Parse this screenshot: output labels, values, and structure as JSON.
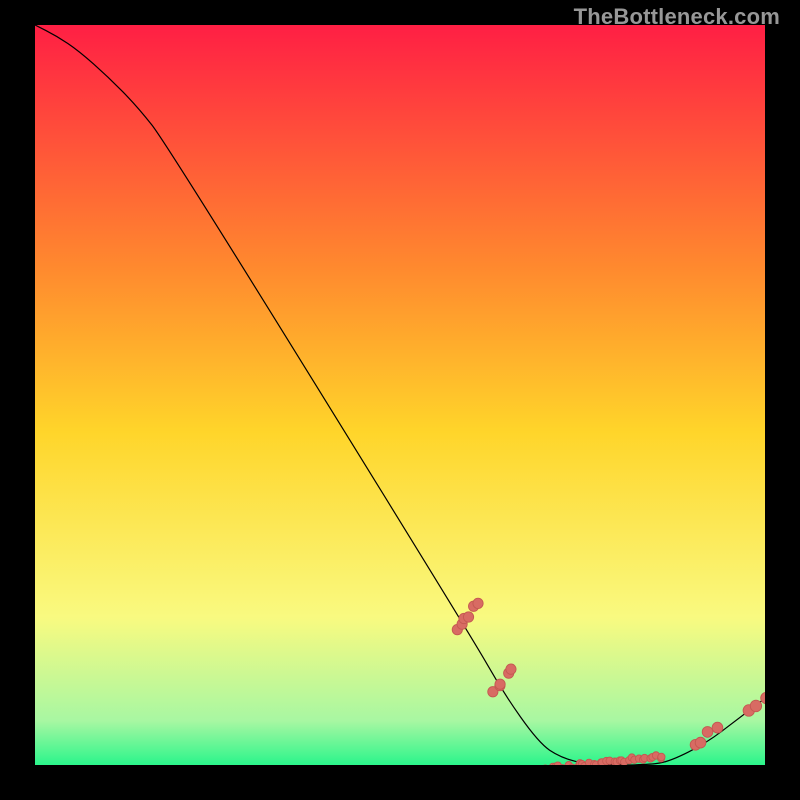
{
  "watermark": "TheBottleneck.com",
  "colors": {
    "background": "#000000",
    "gradient_top": "#ff1f44",
    "gradient_upper_mid": "#ff8a2e",
    "gradient_mid": "#ffd52a",
    "gradient_lower_mid": "#f9fa80",
    "gradient_high": "#a8f7a2",
    "gradient_bottom": "#2bf58b",
    "curve": "#000000",
    "dot_fill": "#d86b63",
    "dot_stroke": "#c45851"
  },
  "chart_data": {
    "type": "line",
    "title": "",
    "xlabel": "",
    "ylabel": "",
    "xlim": [
      0,
      100
    ],
    "ylim": [
      0,
      100
    ],
    "curve": [
      {
        "x": 0,
        "y": 100
      },
      {
        "x": 3,
        "y": 98.5
      },
      {
        "x": 6,
        "y": 96.5
      },
      {
        "x": 10,
        "y": 93
      },
      {
        "x": 14,
        "y": 89
      },
      {
        "x": 18,
        "y": 84
      },
      {
        "x": 60,
        "y": 17
      },
      {
        "x": 64,
        "y": 10
      },
      {
        "x": 69,
        "y": 3
      },
      {
        "x": 72,
        "y": 1
      },
      {
        "x": 76,
        "y": 0
      },
      {
        "x": 84,
        "y": 0
      },
      {
        "x": 87,
        "y": 0.5
      },
      {
        "x": 92,
        "y": 3
      },
      {
        "x": 96,
        "y": 6
      },
      {
        "x": 100,
        "y": 9
      }
    ],
    "scatter_clusters": [
      {
        "x_min": 57.5,
        "x_max": 60.5,
        "y_min": 18,
        "y_max": 22,
        "count": 6,
        "size": 2.5,
        "spread": 0.9
      },
      {
        "x_min": 62.5,
        "x_max": 65.5,
        "y_min": 9.5,
        "y_max": 13,
        "count": 5,
        "size": 2.5,
        "spread": 0.9
      },
      {
        "x_min": 70,
        "x_max": 86,
        "y_min": -0.5,
        "y_max": 1.2,
        "count": 36,
        "size": 1.8,
        "spread": 0.55
      },
      {
        "x_min": 90.5,
        "x_max": 93.5,
        "y_min": 2.5,
        "y_max": 5.0,
        "count": 4,
        "size": 2.6,
        "spread": 0.9
      },
      {
        "x_min": 97.5,
        "x_max": 99.9,
        "y_min": 7.0,
        "y_max": 9.0,
        "count": 3,
        "size": 2.8,
        "spread": 0.9
      }
    ]
  }
}
